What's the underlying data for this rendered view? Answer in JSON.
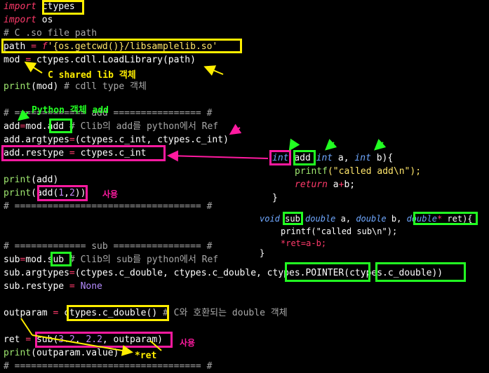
{
  "code": {
    "l1_kw": "import",
    "l1_mod": "ctypes",
    "l2_kw": "import",
    "l2_mod": "os",
    "l3": "# C .so file path",
    "l4_a": "path ",
    "l4_op": "=",
    "l4_f": " f",
    "l4_str": "'{os.getcwd()}/libsamplelib.so'",
    "l5_a": "mod ",
    "l5_op": "=",
    "l5_b": " ctypes.cdll.LoadLibrary(path)",
    "l6_fn": "print",
    "l6_rest": "(mod)",
    "l6_cm": " # cdll type 객체",
    "l7": "# ============= add ================ #",
    "l8_a": "add",
    "l8_op": "=",
    "l8_b": "mod.add",
    "l8_cm": " # Clib의 add를 python에서 Ref",
    "l9_a": "add.argtypes",
    "l9_op": "=",
    "l9_b": "(ctypes.c_int, ctypes.c_int)",
    "l10_a": "add.restype ",
    "l10_op": "=",
    "l10_b": " ctypes.c_int",
    "l11_fn": "print",
    "l11_b": "(add)",
    "l12_fn": "print",
    "l12_b": "(add(",
    "l12_n1": "1",
    "l12_c": ",",
    "l12_n2": "2",
    "l12_d": "))",
    "l13": "# ================================== #",
    "l14": "# ============= sub ================ #",
    "l15_a": "sub",
    "l15_op": "=",
    "l15_b": "mod.sub",
    "l15_cm": " # Clib의 sub를 python에서 Ref",
    "l16_a": "sub.argtypes",
    "l16_op": "=",
    "l16_b": "(ctypes.c_double, ctypes.c_double, ctypes.POINTER(ctypes.c_double))",
    "l17_a": "sub.restype ",
    "l17_op": "=",
    "l17_none": " None",
    "l18_a": "outparam ",
    "l18_op": "=",
    "l18_b": " ctypes.c_double()",
    "l18_cm": " # C와 호환되는 double 객체",
    "l19_a": "ret ",
    "l19_op": "=",
    "l19_b": " sub(",
    "l19_n1": "3.2",
    "l19_c": ", ",
    "l19_n2": "2.2",
    "l19_d": ", outparam)",
    "l20_fn": "print",
    "l20_b": "(outparam.value)",
    "l21": "# ================================== #"
  },
  "c_code": {
    "add_sig_type": "int",
    "add_sig_name": "add",
    "add_sig_p1t": " int",
    "add_sig_p1": " a, ",
    "add_sig_p2t": "int",
    "add_sig_p2": " b){",
    "add_body1_fn": "printf",
    "add_body1_str": "(\"called add\\n\");",
    "add_body2_kw": "return",
    "add_body2_rest": " a",
    "add_body2_op": "+",
    "add_body2_b": "b;",
    "add_close": "}",
    "sub_sig_type": "void",
    "sub_sig_name": "sub",
    "sub_sig_p1t": " double",
    "sub_sig_p1": " a, ",
    "sub_sig_p2t": "double",
    "sub_sig_p2": " b, ",
    "sub_sig_p3t": "double",
    "sub_sig_p3s": "*",
    "sub_sig_p3": " ret){",
    "sub_body1_fn": "printf",
    "sub_body1_str": "(\"called sub\\n\");",
    "sub_body2_a": "*ret",
    "sub_body2_op": "=",
    "sub_body2_b": "a",
    "sub_body2_op2": "-",
    "sub_body2_c": "b;",
    "sub_close": "}"
  },
  "annotations": {
    "c_shared_lib": "C shared lib 객체",
    "python_obj_add": "Python 객체 add",
    "usage1": "사용",
    "usage2": "사용",
    "ret_note": "*ret"
  },
  "colors": {
    "background": "#000000",
    "keyword": "#ff3a6b",
    "comment": "#a8a8a8",
    "function": "#9fe870",
    "string": "#ffe66b",
    "c_keyword": "#6fa8ff",
    "box_yellow": "#ffee00",
    "box_green": "#22ff22",
    "box_magenta": "#ff1aa0"
  }
}
